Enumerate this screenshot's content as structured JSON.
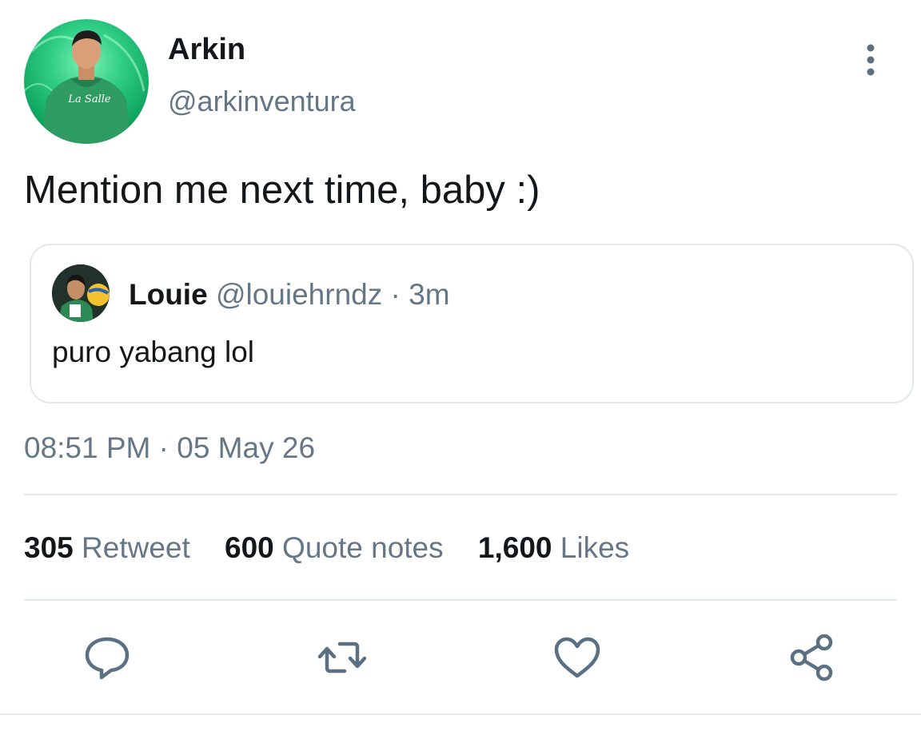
{
  "tweet": {
    "author": {
      "name": "Arkin",
      "handle": "@arkinventura",
      "avatar_shirt_text": "La Salle"
    },
    "text": "Mention me next time, baby :)",
    "timestamp": "08:51 PM · 05 May 26"
  },
  "quoted_tweet": {
    "author_name": "Louie",
    "author_handle": "@louiehrndz",
    "time_ago": "· 3m",
    "text": "puro yabang lol"
  },
  "stats": [
    {
      "count": "305",
      "label": "Retweet"
    },
    {
      "count": "600",
      "label": "Quote notes"
    },
    {
      "count": "1,600",
      "label": "Likes"
    }
  ],
  "actions": {
    "reply_icon": "reply-icon",
    "retweet_icon": "retweet-icon",
    "like_icon": "heart-icon",
    "share_icon": "share-icon",
    "menu_icon": "more-vertical-icon"
  },
  "colors": {
    "text": "#14171a",
    "secondary": "#657786",
    "border": "#e1e8ed",
    "icon": "#5b7083"
  }
}
